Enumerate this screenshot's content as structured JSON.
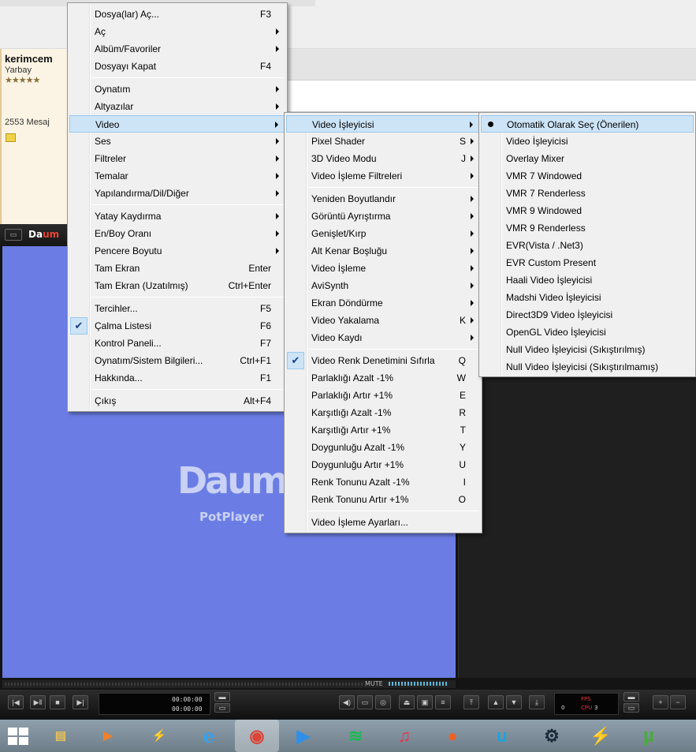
{
  "forum": {
    "username": "kerimcem",
    "rank": "Yarbay",
    "stars": "★★★★★",
    "post_count": "2553 Mesaj"
  },
  "player": {
    "title_logo_prefix": "Da",
    "title_logo_suffix": "um",
    "logo_big": "Daum",
    "logo_sub": "PotPlayer",
    "mute_label": "MUTE",
    "time_current": "00:00:00",
    "time_total": "00:00:00",
    "fps_label": "FPS",
    "cpu_label": "CPU",
    "fps_value": "0",
    "cpu_value": "3"
  },
  "main_menu": {
    "items": [
      {
        "label": "Dosya(lar) Aç...",
        "shortcut": "F3"
      },
      {
        "label": "Aç",
        "submenu": true
      },
      {
        "label": "Albüm/Favoriler",
        "submenu": true
      },
      {
        "label": "Dosyayı Kapat",
        "shortcut": "F4"
      },
      {
        "label": "Oynatım",
        "submenu": true
      },
      {
        "label": "Altyazılar",
        "submenu": true
      },
      {
        "label": "Video",
        "submenu": true,
        "highlighted": true
      },
      {
        "label": "Ses",
        "submenu": true
      },
      {
        "label": "Filtreler",
        "submenu": true
      },
      {
        "label": "Temalar",
        "submenu": true
      },
      {
        "label": "Yapılandırma/Dil/Diğer",
        "submenu": true
      },
      {
        "label": "Yatay Kaydırma",
        "submenu": true
      },
      {
        "label": "En/Boy Oranı",
        "submenu": true
      },
      {
        "label": "Pencere Boyutu",
        "submenu": true
      },
      {
        "label": "Tam Ekran",
        "shortcut": "Enter"
      },
      {
        "label": "Tam Ekran (Uzatılmış)",
        "shortcut": "Ctrl+Enter"
      },
      {
        "label": "Tercihler...",
        "shortcut": "F5"
      },
      {
        "label": "Çalma Listesi",
        "shortcut": "F6",
        "checked": true
      },
      {
        "label": "Kontrol Paneli...",
        "shortcut": "F7"
      },
      {
        "label": "Oynatım/Sistem Bilgileri...",
        "shortcut": "Ctrl+F1"
      },
      {
        "label": "Hakkında...",
        "shortcut": "F1"
      },
      {
        "label": "Çıkış",
        "shortcut": "Alt+F4"
      }
    ]
  },
  "video_menu": {
    "items": [
      {
        "label": "Video İşleyicisi",
        "submenu": true,
        "highlighted": true
      },
      {
        "label": "Pixel Shader",
        "shortcut": "S",
        "submenu": true
      },
      {
        "label": "3D Video Modu",
        "shortcut": "J",
        "submenu": true
      },
      {
        "label": "Video İşleme Filtreleri",
        "submenu": true
      },
      {
        "label": "Yeniden Boyutlandır",
        "submenu": true
      },
      {
        "label": "Görüntü Ayrıştırma",
        "submenu": true
      },
      {
        "label": "Genişlet/Kırp",
        "submenu": true
      },
      {
        "label": "Alt Kenar Boşluğu",
        "submenu": true
      },
      {
        "label": "Video İşleme",
        "submenu": true
      },
      {
        "label": "AviSynth",
        "submenu": true
      },
      {
        "label": "Ekran Döndürme",
        "submenu": true
      },
      {
        "label": "Video Yakalama",
        "shortcut": "K",
        "submenu": true
      },
      {
        "label": "Video Kaydı",
        "submenu": true
      },
      {
        "label": "Video Renk Denetimini Sıfırla",
        "shortcut": "Q",
        "checked": true
      },
      {
        "label": "Parlaklığı Azalt -1%",
        "shortcut": "W"
      },
      {
        "label": "Parlaklığı Artır +1%",
        "shortcut": "E"
      },
      {
        "label": "Karşıtlığı Azalt -1%",
        "shortcut": "R"
      },
      {
        "label": "Karşıtlığı Artır +1%",
        "shortcut": "T"
      },
      {
        "label": "Doygunluğu Azalt -1%",
        "shortcut": "Y"
      },
      {
        "label": "Doygunluğu Artır +1%",
        "shortcut": "U"
      },
      {
        "label": "Renk Tonunu Azalt -1%",
        "shortcut": "I"
      },
      {
        "label": "Renk Tonunu Artır +1%",
        "shortcut": "O"
      },
      {
        "label": "Video İşleme Ayarları..."
      }
    ]
  },
  "renderer_menu": {
    "items": [
      {
        "label": "Otomatik Olarak Seç (Önerilen)",
        "selected": true
      },
      {
        "label": "Video İşleyicisi"
      },
      {
        "label": "Overlay Mixer"
      },
      {
        "label": "VMR 7 Windowed"
      },
      {
        "label": "VMR 7 Renderless"
      },
      {
        "label": "VMR 9 Windowed"
      },
      {
        "label": "VMR 9 Renderless"
      },
      {
        "label": "EVR(Vista / .Net3)"
      },
      {
        "label": "EVR Custom Present"
      },
      {
        "label": "Haali Video İşleyicisi"
      },
      {
        "label": "Madshi Video İşleyicisi"
      },
      {
        "label": "Direct3D9 Video İşleyicisi"
      },
      {
        "label": "OpenGL Video İşleyicisi"
      },
      {
        "label": "Null Video İşleyicisi (Sıkıştırılmış)"
      },
      {
        "label": "Null Video İşleyicisi (Sıkıştırılmamış)"
      }
    ]
  },
  "taskbar": {
    "items": [
      {
        "name": "start-button",
        "glyph": ""
      },
      {
        "name": "file-explorer",
        "glyph": "▤",
        "color": "#e8c25a"
      },
      {
        "name": "media-player",
        "glyph": "▶",
        "color": "#f0802a"
      },
      {
        "name": "winamp",
        "glyph": "⚡",
        "color": "#f2b02c"
      },
      {
        "name": "internet-explorer",
        "glyph": "e",
        "color": "#3aa0e8"
      },
      {
        "name": "chrome",
        "glyph": "◉",
        "color": "#db4437"
      },
      {
        "name": "potplayer",
        "glyph": "▶",
        "color": "#2f8fe8"
      },
      {
        "name": "spotify",
        "glyph": "≋",
        "color": "#1db954"
      },
      {
        "name": "itunes",
        "glyph": "♫",
        "color": "#e8344e"
      },
      {
        "name": "maps",
        "glyph": "●",
        "color": "#e8632a"
      },
      {
        "name": "uplay",
        "glyph": "u",
        "color": "#1aa3e0"
      },
      {
        "name": "steam",
        "glyph": "⚙",
        "color": "#1b2838"
      },
      {
        "name": "lightning-app",
        "glyph": "⚡",
        "color": "#2a7de8"
      },
      {
        "name": "utorrent",
        "glyph": "µ",
        "color": "#4aab3c"
      }
    ]
  }
}
